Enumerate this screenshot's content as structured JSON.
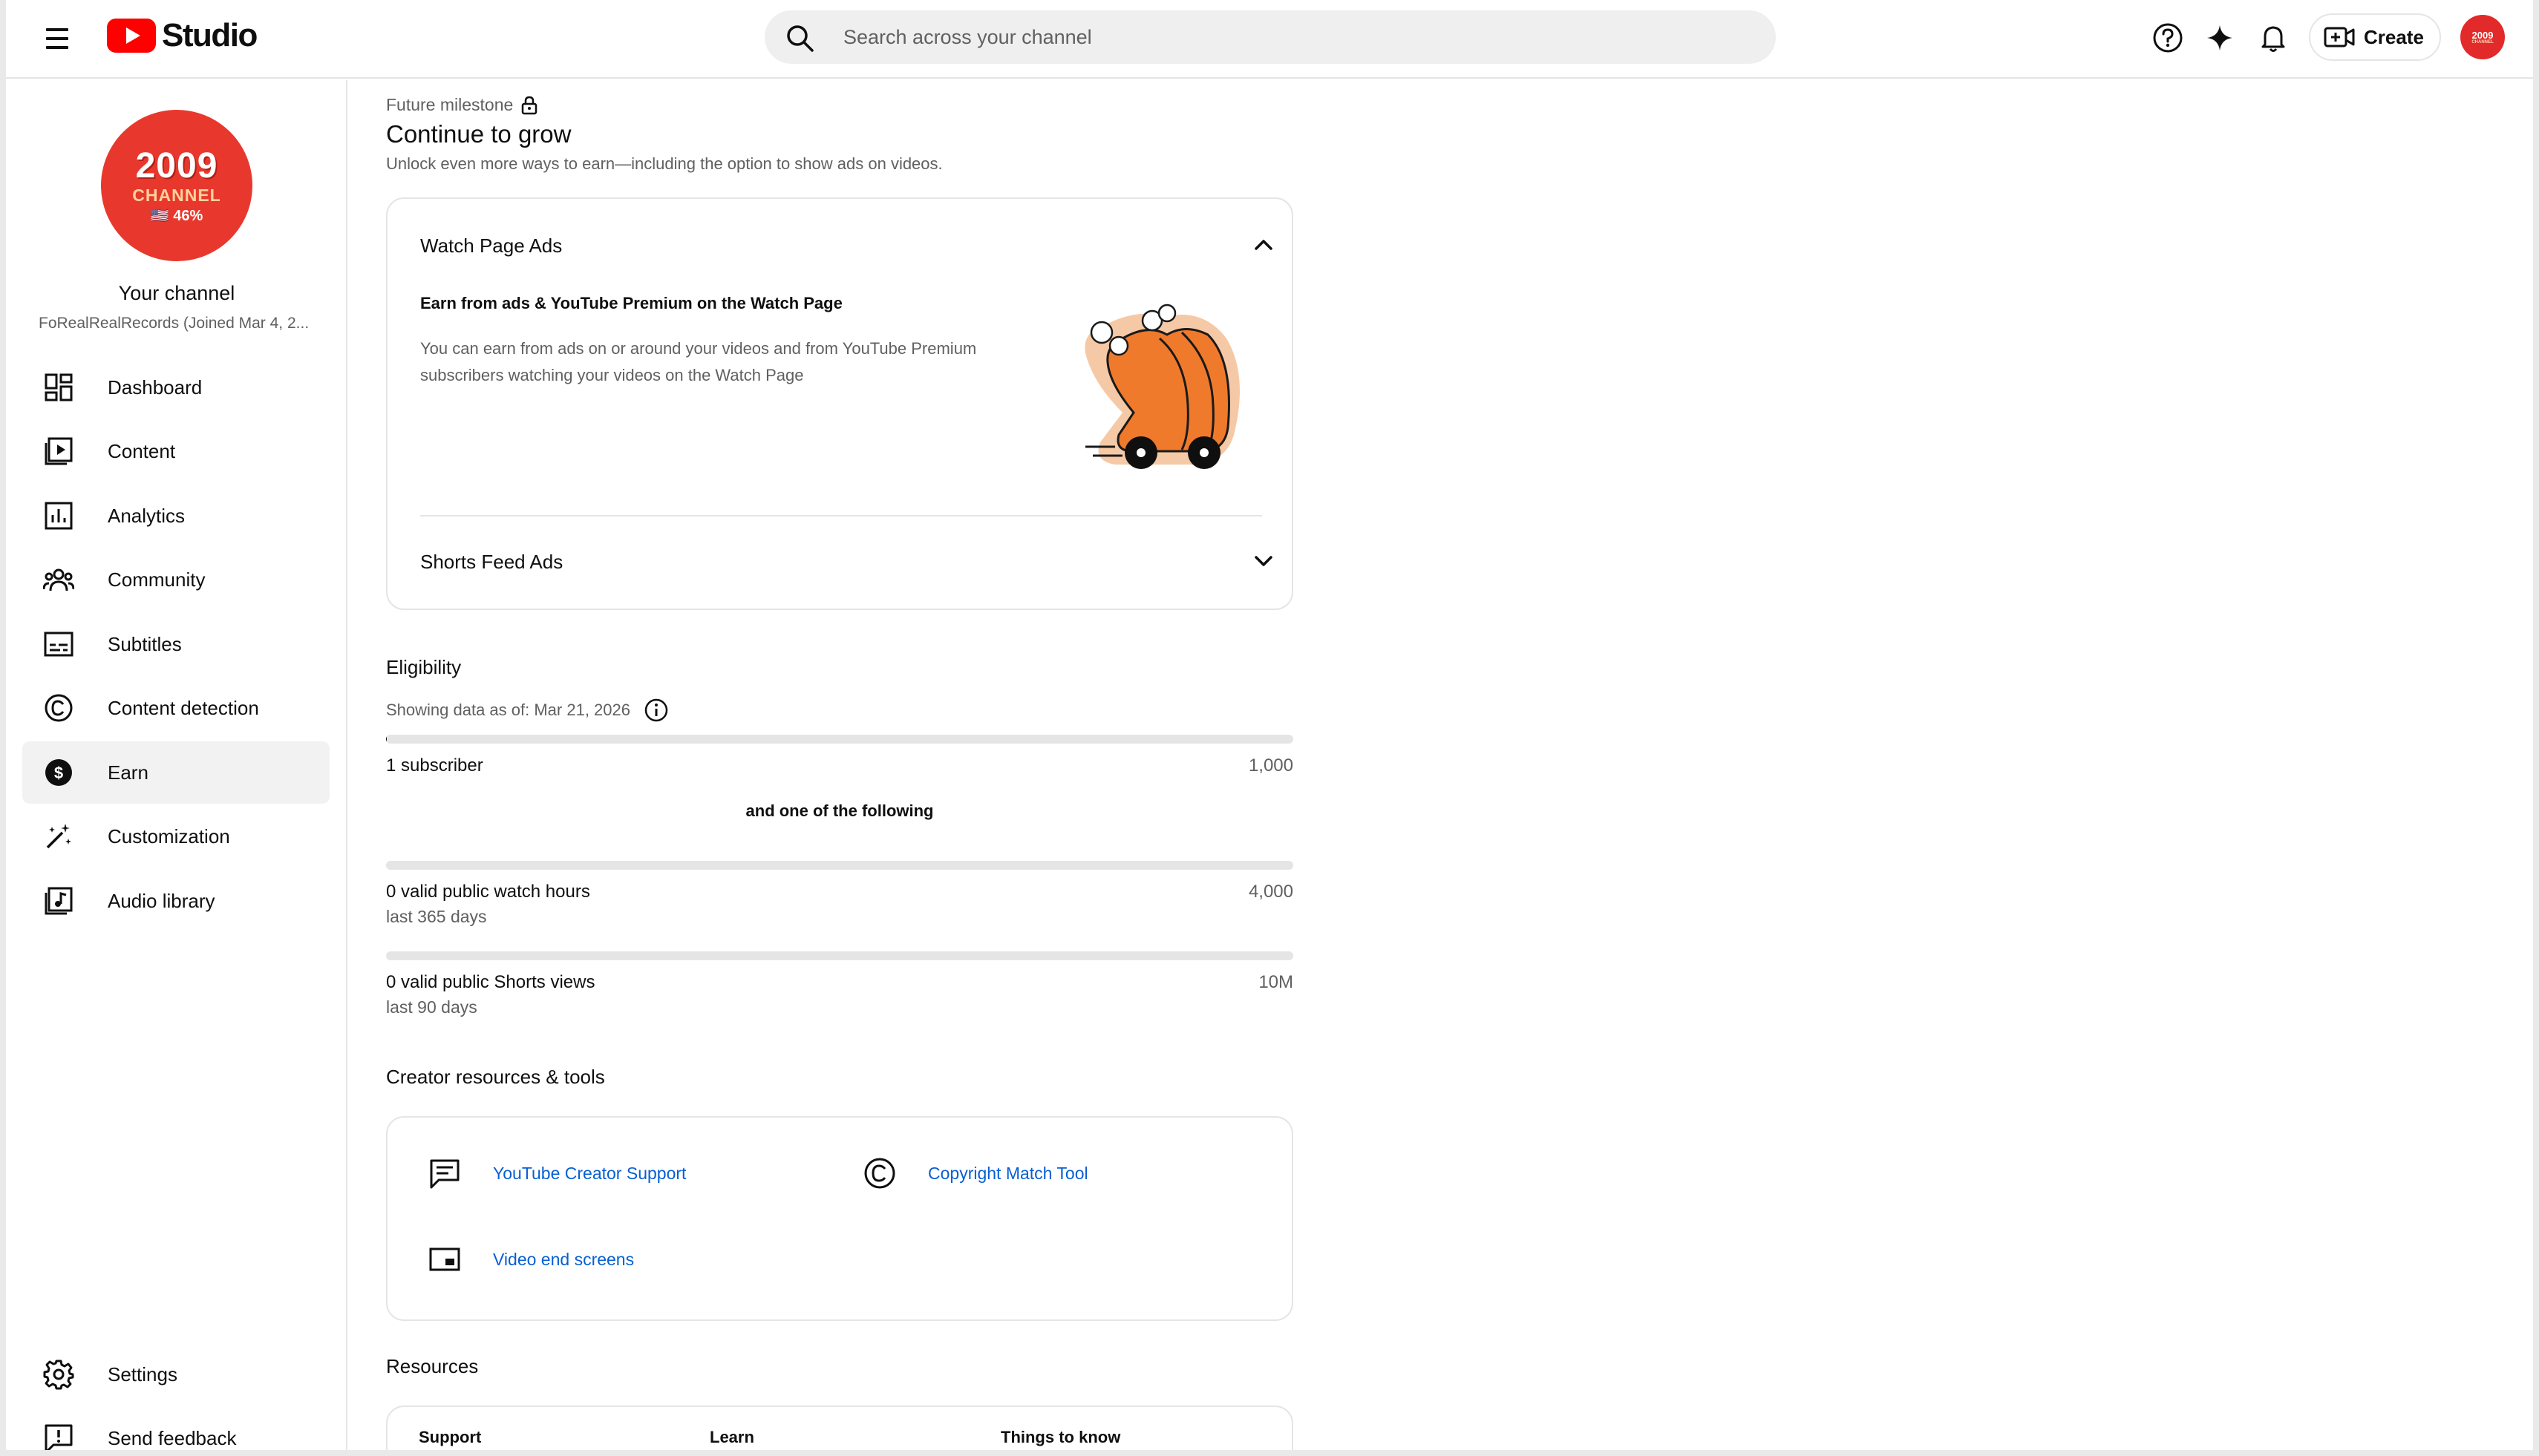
{
  "header": {
    "app_name": "Studio",
    "search_placeholder": "Search across your channel",
    "create_label": "Create",
    "avatar_year": "2009",
    "avatar_sub": "CHANNEL"
  },
  "sidebar": {
    "avatar": {
      "year": "2009",
      "line": "CHANNEL",
      "percent": "🇺🇸 46%"
    },
    "your_channel": "Your channel",
    "channel_name": "FoRealRealRecords (Joined Mar 4, 2...",
    "items": [
      {
        "label": "Dashboard",
        "icon": "dashboard-icon"
      },
      {
        "label": "Content",
        "icon": "content-icon"
      },
      {
        "label": "Analytics",
        "icon": "analytics-icon"
      },
      {
        "label": "Community",
        "icon": "community-icon"
      },
      {
        "label": "Subtitles",
        "icon": "subtitles-icon"
      },
      {
        "label": "Content detection",
        "icon": "copyright-icon"
      },
      {
        "label": "Earn",
        "icon": "dollar-icon",
        "active": true
      },
      {
        "label": "Customization",
        "icon": "magic-wand-icon"
      },
      {
        "label": "Audio library",
        "icon": "audio-library-icon"
      }
    ],
    "bottom": [
      {
        "label": "Settings",
        "icon": "gear-icon"
      },
      {
        "label": "Send feedback",
        "icon": "feedback-icon"
      }
    ]
  },
  "main": {
    "milestone": "Future milestone",
    "title": "Continue to grow",
    "subtitle": "Unlock even more ways to earn—including the option to show ads on videos.",
    "accordion": {
      "watch_page_ads": {
        "header": "Watch Page Ads",
        "expanded": true,
        "title": "Earn from ads & YouTube Premium on the Watch Page",
        "body": "You can earn from ads on or around your videos and from YouTube Premium subscribers watching your videos on the Watch Page"
      },
      "shorts_feed_ads": {
        "header": "Shorts Feed Ads",
        "expanded": false
      }
    },
    "eligibility": {
      "title": "Eligibility",
      "showing": "Showing data as of: Mar 21, 2026",
      "subscribers": {
        "label": "1 subscriber",
        "target": "1,000",
        "progress": 0.001
      },
      "and_one": "and one of the following",
      "watch_hours": {
        "label": "0 valid public watch hours",
        "period": "last 365 days",
        "target": "4,000",
        "progress": 0
      },
      "shorts_views": {
        "label": "0 valid public Shorts views",
        "period": "last 90 days",
        "target": "10M",
        "progress": 0
      }
    },
    "creator_tools": {
      "title": "Creator resources & tools",
      "links": [
        {
          "label": "YouTube Creator Support",
          "icon": "chat-icon"
        },
        {
          "label": "Copyright Match Tool",
          "icon": "copyright-icon"
        },
        {
          "label": "Video end screens",
          "icon": "end-screen-icon"
        }
      ]
    },
    "resources": {
      "title": "Resources",
      "columns": [
        "Support",
        "Learn",
        "Things to know"
      ]
    }
  },
  "colors": {
    "brand_red": "#ff0000",
    "link": "#065fd4",
    "illustration_orange": "#f07a2c"
  }
}
